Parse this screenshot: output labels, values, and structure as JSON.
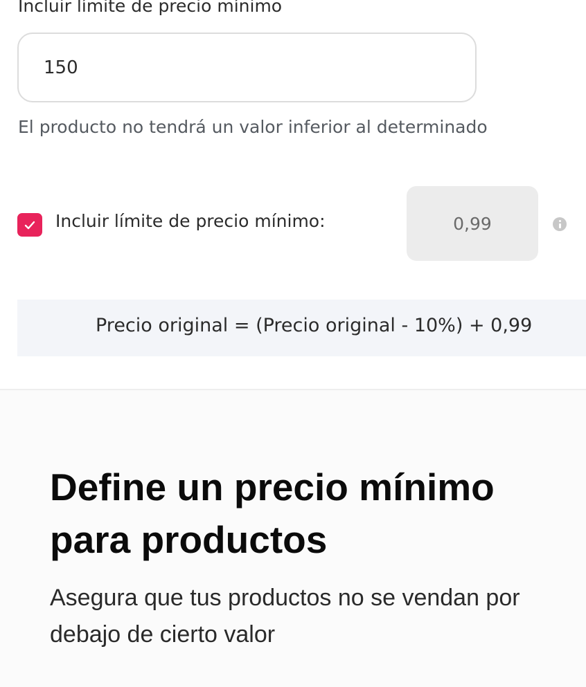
{
  "min_price_setting": {
    "field_label": "Incluir límite de precio mínimo",
    "input_value": "150",
    "helper_text": "El producto no tendrá un valor inferior al determinado",
    "checkbox_checked": true,
    "checkbox_label": "Incluir límite de precio mínimo:",
    "min_value": "0,99",
    "info_icon": "info-icon",
    "formula": "Precio original = (Precio original - 10%) + 0,99"
  },
  "feature": {
    "title": "Define un precio mínimo para productos",
    "description": "Asegura que tus productos no se vendan por debajo de cierto valor"
  },
  "colors": {
    "accent": "#e8235b",
    "formula_background": "#f3f5f9",
    "disabled_field": "#ececec"
  }
}
